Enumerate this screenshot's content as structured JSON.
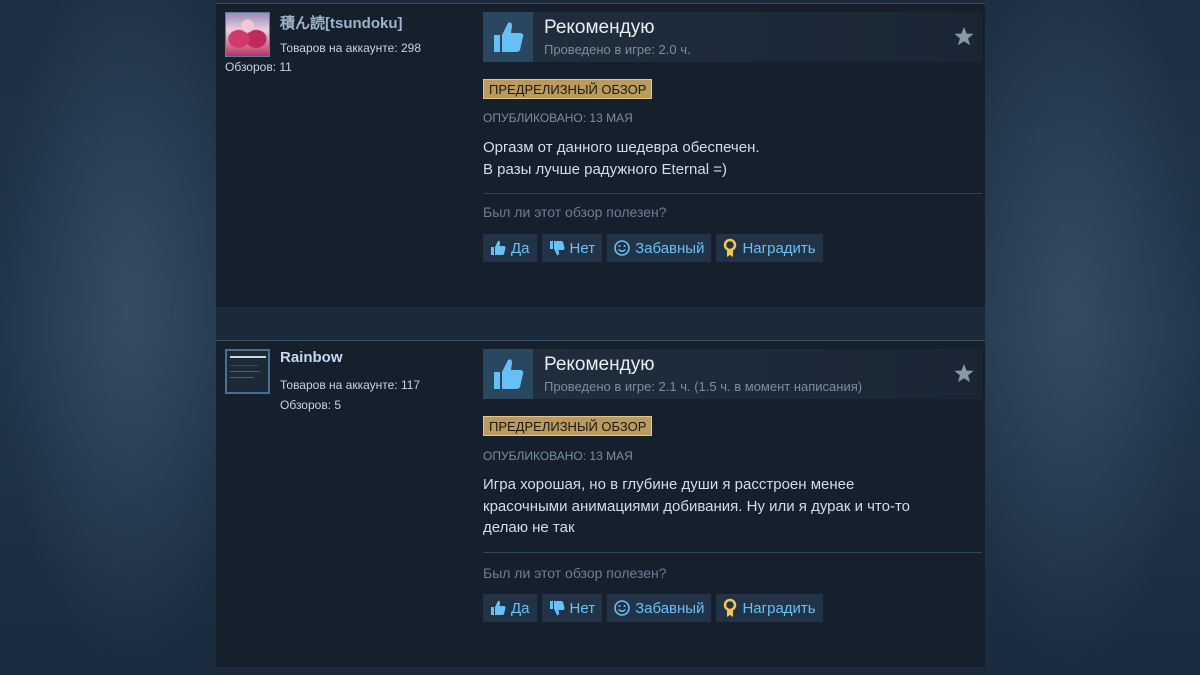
{
  "reviews": [
    {
      "author": {
        "name": "積ん読[tsundoku]",
        "products": "Товаров на аккаунте: 298",
        "reviews": "Обзоров: 11"
      },
      "verdict": "Рекомендую",
      "hours": "Проведено в игре: 2.0 ч.",
      "badge": "ПРЕДРЕЛИЗНЫЙ ОБЗОР",
      "posted": "Опубликовано: 13 мая",
      "content_lines": [
        "Оргазм от данного шедевра обеспечен.",
        "В разы лучше радужного Eternal =)"
      ],
      "helpful_question": "Был ли этот обзор полезен?"
    },
    {
      "author": {
        "name": "Rainbow",
        "products": "Товаров на аккаунте: 117",
        "reviews": "Обзоров: 5"
      },
      "verdict": "Рекомендую",
      "hours": "Проведено в игре: 2.1 ч. (1.5 ч. в момент написания)",
      "badge": "ПРЕДРЕЛИЗНЫЙ ОБЗОР",
      "posted": "Опубликовано: 13 мая",
      "content_lines": [
        "Игра хорошая, но в глубине души я расстроен менее",
        "красочными анимациями добивания. Ну или я дурак и что-то",
        "делаю не так"
      ],
      "helpful_question": "Был ли этот обзор полезен?"
    }
  ],
  "buttons": {
    "yes": "Да",
    "no": "Нет",
    "funny": "Забавный",
    "award": "Наградить"
  },
  "colors": {
    "accent": "#67c1f5",
    "badge": "#bb9a5e",
    "background": "#1b2838"
  },
  "icons": [
    "thumbs-up-icon",
    "star-icon",
    "thumbs-up-small-icon",
    "thumbs-down-icon",
    "smiley-icon",
    "award-icon"
  ]
}
